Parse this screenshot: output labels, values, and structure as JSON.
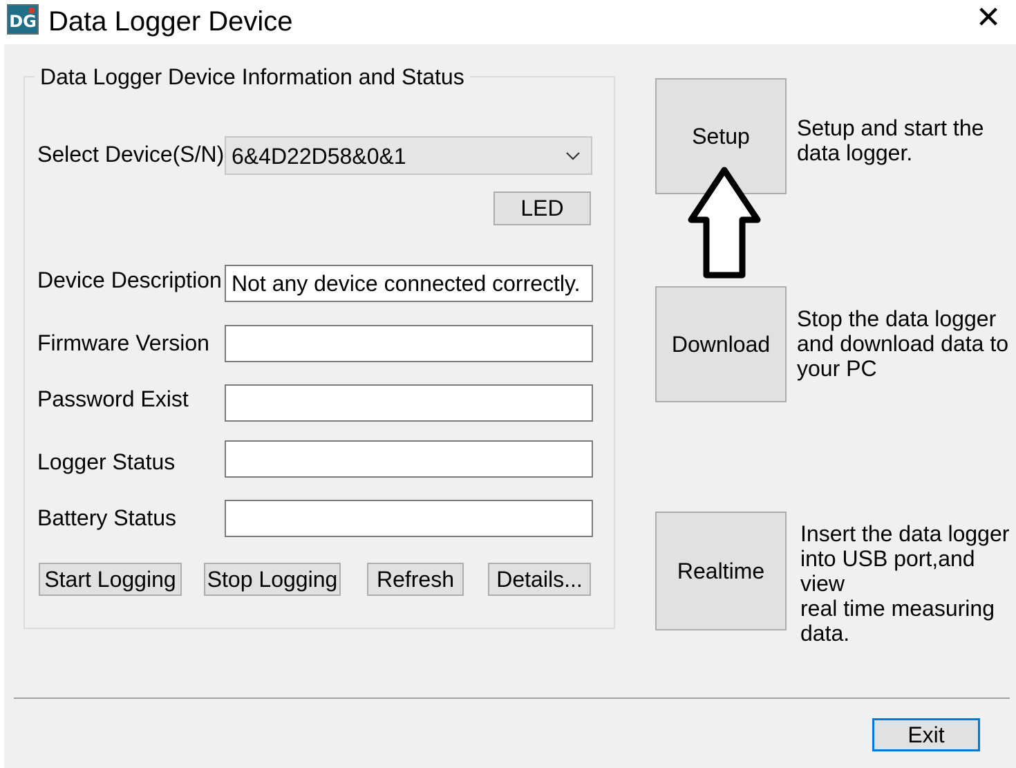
{
  "window": {
    "title": "Data Logger Device",
    "icon_text": "DG",
    "close_glyph": "✕"
  },
  "group": {
    "title": "Data Logger Device Information and Status",
    "select_label": "Select Device(S/N)",
    "select_value": "6&4D22D58&0&1",
    "led_label": "LED",
    "fields": [
      {
        "label": "Device Description",
        "value": "Not any device connected correctly."
      },
      {
        "label": "Firmware Version",
        "value": ""
      },
      {
        "label": "Password Exist",
        "value": ""
      },
      {
        "label": "Logger Status",
        "value": ""
      },
      {
        "label": "Battery Status",
        "value": ""
      }
    ],
    "buttons": {
      "start": "Start Logging",
      "stop": "Stop Logging",
      "refresh": "Refresh",
      "details": "Details..."
    }
  },
  "actions": {
    "setup": {
      "label": "Setup",
      "desc": [
        "Setup and start the",
        "data logger."
      ]
    },
    "download": {
      "label": "Download",
      "desc": [
        "Stop the data logger",
        "and download data to",
        "your PC"
      ]
    },
    "realtime": {
      "label": "Realtime",
      "desc": [
        "Insert the data logger",
        "into USB port,and view",
        "real time measuring",
        "data."
      ]
    }
  },
  "footer": {
    "exit_label": "Exit"
  },
  "colors": {
    "dialog_bg": "#f0f0f0",
    "button_bg": "#e1e1e1",
    "focus_border": "#0078d7"
  }
}
